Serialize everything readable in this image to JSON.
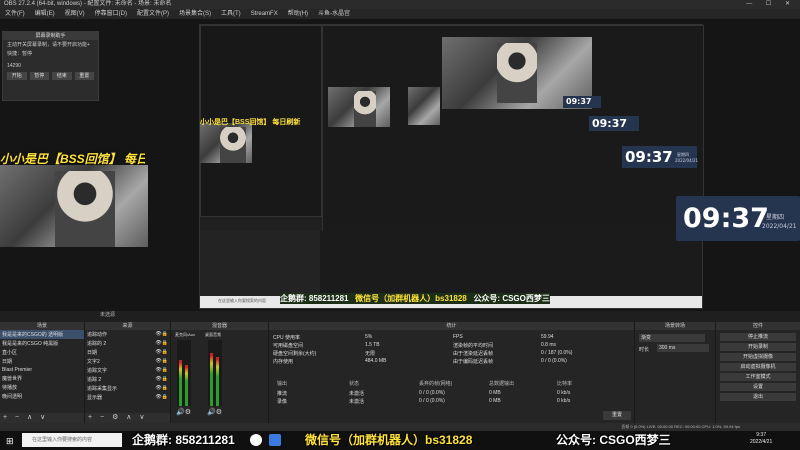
{
  "window": {
    "title": "OBS 27.2.4 (64-bit, windows) - 配置文件: 未命名 - 场景: 未命名",
    "controls": "— ☐ ✕"
  },
  "menu": [
    "文件(F)",
    "编辑(E)",
    "视图(V)",
    "停靠窗口(D)",
    "配置文件(P)",
    "场景集合(S)",
    "工具(T)",
    "StreamFX",
    "帮助(H)",
    "斗鱼-水晶宫"
  ],
  "script_panel": {
    "title": "屏幕录制助手",
    "lines": [
      "主动开关屏幕录制，请不要开启功能+",
      "快捷：暂停"
    ],
    "counter": "14290",
    "buttons": [
      "开始",
      "暂停",
      "结束",
      "重置"
    ]
  },
  "scroll_text": "小小是巴【BSS回馆】 每日刷新",
  "nested_clocks": [
    {
      "time": "09:37"
    },
    {
      "time": "09:37"
    },
    {
      "time": "09:37",
      "date": "星期四",
      "date2": "2022/04/21"
    },
    {
      "time": "09:37",
      "date": "星期四",
      "date2": "2022/04/21"
    }
  ],
  "nested_banner": {
    "qq": "企鹅群: 858211281",
    "wx": "微信号（加群机器人）bs31828",
    "gzh": "公众号: CSGO西梦三"
  },
  "nested_search": "在这里输入你要搜索的内容",
  "preview_label": "未选源",
  "scenes": {
    "title": "场景",
    "items": [
      "我是是来的CSGO的 透明版",
      "我是是来的CSGO 纯黑版",
      "直小区",
      "日期",
      "Blast Premier",
      "魔兽世界",
      "待播放",
      "晚间透明"
    ],
    "foot": "+ − ∧ ∨"
  },
  "sources": {
    "title": "来源",
    "items": [
      "追踪动作",
      "追踪的 2",
      "日期",
      "文字2",
      "追踪文字",
      "追踪 2",
      "追踪采集显示",
      "显示器"
    ],
    "foot": "+ − ⚙ ∧ ∨"
  },
  "mixer": {
    "title": "混音器",
    "channels": [
      {
        "name": "麦克风/Aux"
      },
      {
        "name": "桌面音频"
      }
    ]
  },
  "stats": {
    "title": "统计",
    "left": [
      [
        "CPU 使用率",
        "5%"
      ],
      [
        "可用磁盘空间",
        "1.5 TB"
      ],
      [
        "硬盘空间剩余(大约)",
        "无限"
      ],
      [
        "内存使用",
        "484.0 MB"
      ]
    ],
    "right": [
      [
        "FPS",
        "59.94"
      ],
      [
        "渲染帧的平均时间",
        "0.8 ms"
      ],
      [
        "由于渲染延迟丢帧",
        "0 / 187 (0.0%)"
      ],
      [
        "由于编码延迟丢帧",
        "0 / 0 (0.0%)"
      ]
    ],
    "out_headers": [
      "输出",
      "状态",
      "丢弃的帧(网络)",
      "总数据输出",
      "比特率"
    ],
    "out_rows": [
      [
        "推流",
        "未激活",
        "0 / 0 (0.0%)",
        "0 MB",
        "0 kb/s"
      ],
      [
        "录像",
        "未激活",
        "0 / 0 (0.0%)",
        "0 MB",
        "0 kb/s"
      ]
    ],
    "reset": "重置"
  },
  "transition": {
    "title": "场景转场",
    "type": "渐变",
    "duration_label": "时长",
    "duration": "300 ms"
  },
  "controls": {
    "title": "控件",
    "mode": "停止推流",
    "buttons": [
      "开始录制",
      "开始虚拟摄像",
      "启动虚拟摄像机",
      "工作室模式",
      "设置",
      "退出"
    ]
  },
  "statusbar": {
    "text": "丢帧 0 (0.0%)   LIVE: 00:00:00   REC: 00:00:00   CPU: 1.0%, 59.94 fps"
  },
  "taskbar": {
    "search": "在这里输入你要搜索的内容",
    "time": "9:37",
    "date": "2022/4/21"
  },
  "banner": {
    "qq": "企鹅群: 858211281",
    "wx": "微信号（加群机器人）bs31828",
    "gzh": "公众号: CSGO西梦三"
  }
}
